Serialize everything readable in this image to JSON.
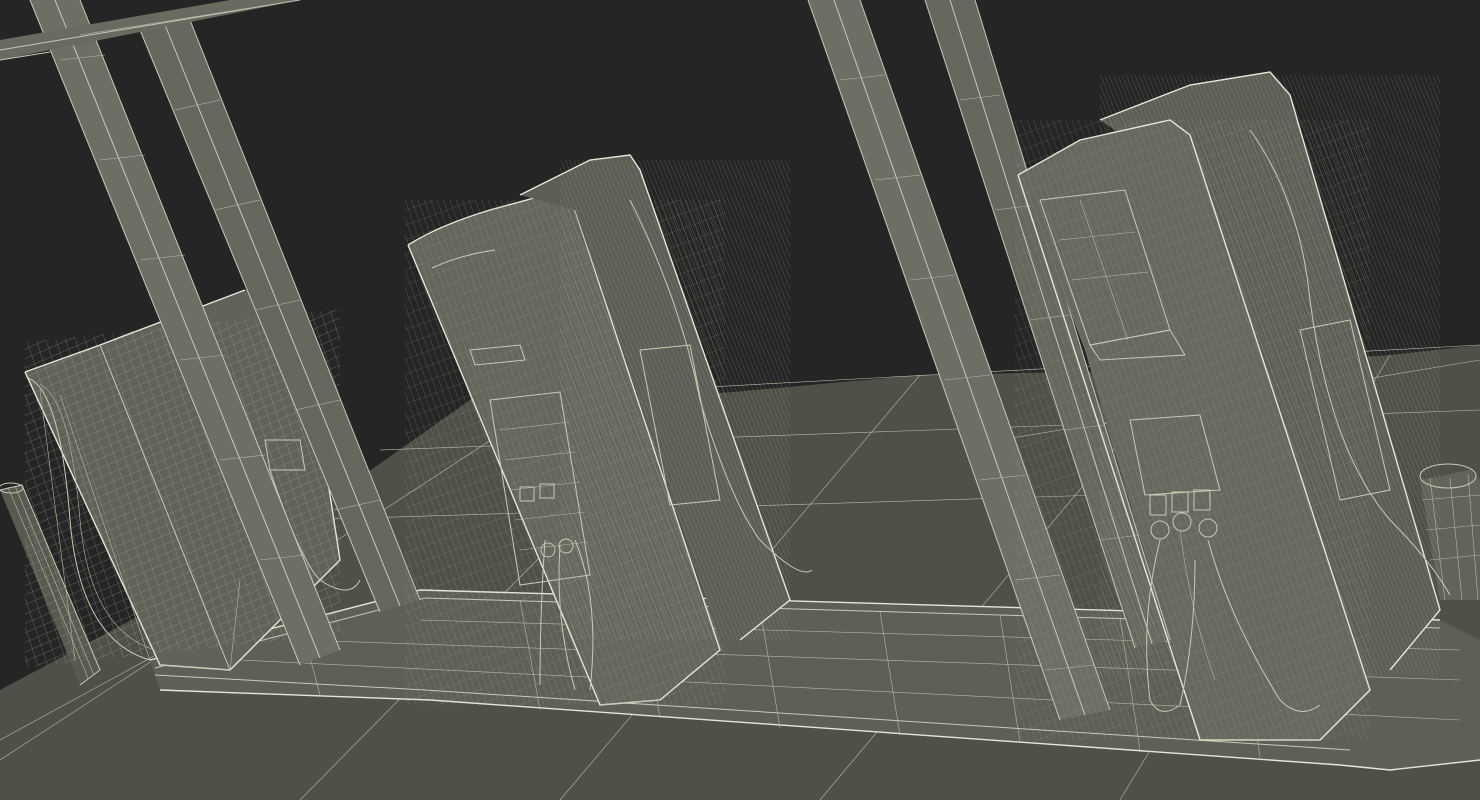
{
  "scene": {
    "subject": "fuel-pump-island-wireframe",
    "colors": {
      "background": "#252525",
      "ground": "#505048",
      "ground_far": "#5a5a52",
      "island": "#5f5f56",
      "mesh_surface": "#6b6b62",
      "mesh_dark": "#4c4c45",
      "wire": "#c9c9b8",
      "wire_highlight": "#e6e6d8"
    }
  }
}
